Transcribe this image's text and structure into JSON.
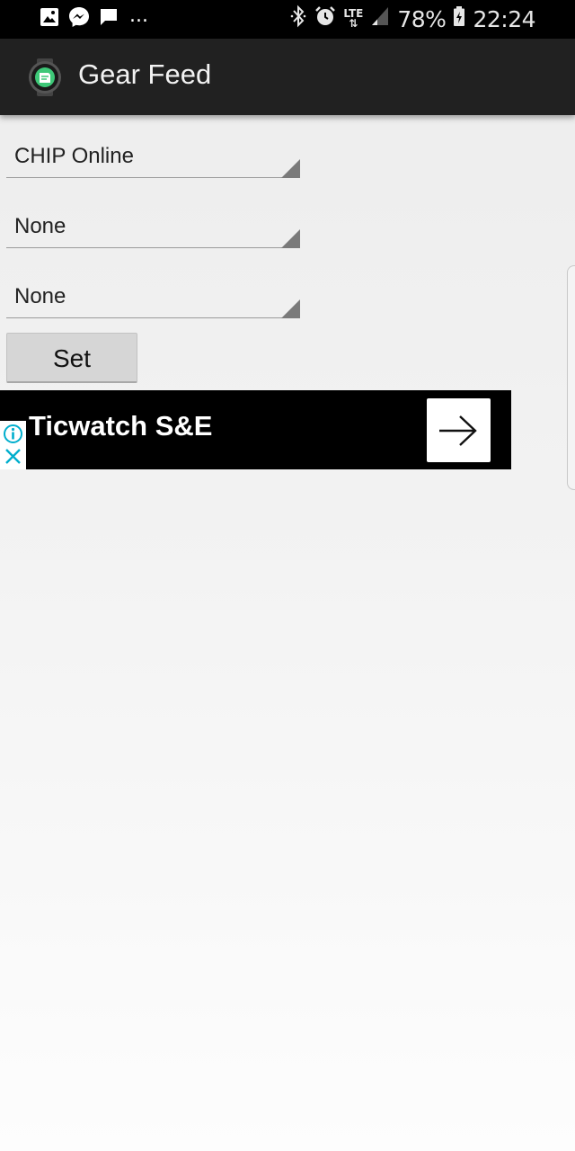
{
  "status_bar": {
    "notification_icons": [
      "image-icon",
      "messenger-icon",
      "chat-icon"
    ],
    "more": "...",
    "status_icons": [
      "bluetooth-icon",
      "alarm-icon",
      "lte-icon",
      "signal-icon"
    ],
    "lte_label": "LTE",
    "battery_percent": "78%",
    "time": "22:24"
  },
  "app_bar": {
    "title": "Gear Feed",
    "icon": "gear-watch-icon"
  },
  "spinners": [
    {
      "value": "CHIP Online"
    },
    {
      "value": "None"
    },
    {
      "value": "None"
    }
  ],
  "set_button": {
    "label": "Set"
  },
  "ad": {
    "title": "Ticwatch S&E",
    "icons": [
      "info-icon",
      "close-icon",
      "arrow-right-icon"
    ]
  },
  "colors": {
    "status_bar_bg": "#000000",
    "app_bar_bg": "#212121",
    "ad_bg": "#000000",
    "ad_choices_accent": "#00aecd",
    "app_icon_green": "#3ec878"
  }
}
